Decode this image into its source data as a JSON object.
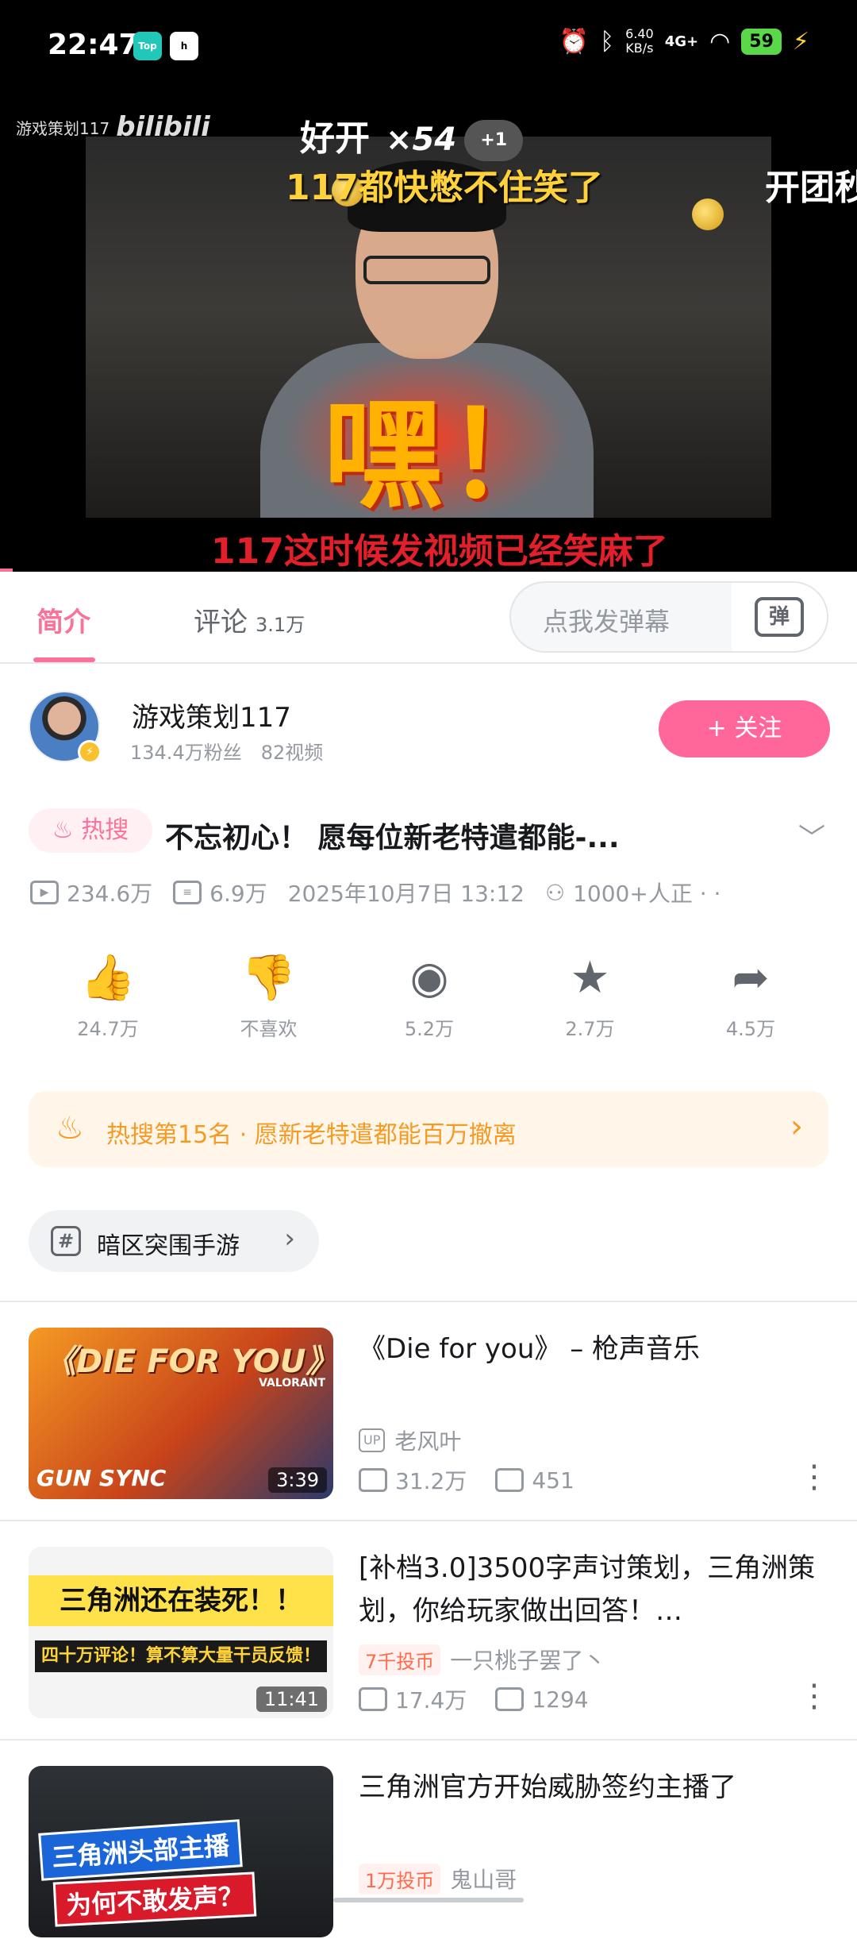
{
  "status_bar": {
    "time": "22:47",
    "app_badges": [
      "Top",
      "h"
    ],
    "net_speed_value": "6.40",
    "net_speed_unit": "KB/s",
    "network": "4G+",
    "battery": "59"
  },
  "player": {
    "watermark": "游戏策划117",
    "watermark_logo": "bilibili",
    "overlay_text": "嘿！",
    "danmu": {
      "combo_text": "好开",
      "combo_mult": "×54",
      "combo_badge": "+1",
      "line2": "117都快憋不住笑了",
      "line3": "开团秒",
      "line4": "117这时候发视频已经笑麻了"
    }
  },
  "tabs": {
    "intro": "简介",
    "comments": "评论",
    "comments_count": "3.1万",
    "danmaku_placeholder": "点我发弹幕",
    "danmaku_button": "弹"
  },
  "uploader": {
    "name": "游戏策划117",
    "fans": "134.4万粉丝",
    "videos": "82视频",
    "follow": "+ 关注"
  },
  "video": {
    "hot_tag": "热搜",
    "title": "不忘初心！ 愿每位新老特遣都能-...",
    "views": "234.6万",
    "danmaku": "6.9万",
    "date": "2025年10月7日 13:12",
    "watching": "1000+人正 · ·"
  },
  "actions": [
    {
      "icon": "thumb-up-icon",
      "count": "24.7万"
    },
    {
      "icon": "thumb-down-icon",
      "count": "不喜欢"
    },
    {
      "icon": "coin-icon",
      "count": "5.2万"
    },
    {
      "icon": "star-icon",
      "count": "2.7万"
    },
    {
      "icon": "share-icon",
      "count": "4.5万"
    }
  ],
  "hot_banner": {
    "text": "热搜第15名 · 愿新老特遣都能百万撤离"
  },
  "topic": {
    "label": "暗区突围手游"
  },
  "recommendations": [
    {
      "title": "《Die for you》 – 枪声音乐",
      "up_tag": "UP",
      "uploader": "老风叶",
      "views": "31.2万",
      "danmaku": "451",
      "duration": "3:39",
      "thumb_text1": "《DIE FOR YOU》",
      "thumb_text2": "GUN SYNC",
      "thumb_text3": "VALORANT"
    },
    {
      "title": "[补档3.0]3500字声讨策划，三角洲策划，你给玩家做出回答！…",
      "coin_tag": "7千投币",
      "uploader": "一只桃子罢了丶",
      "views": "17.4万",
      "danmaku": "1294",
      "duration": "11:41",
      "thumb_text1": "三角洲还在装死！！",
      "thumb_text2": "四十万评论！算不算大量干员反馈！"
    },
    {
      "title": "三角洲官方开始威胁签约主播了",
      "coin_tag": "1万投币",
      "uploader": "鬼山哥",
      "thumb_text1": "三角洲头部主播",
      "thumb_text2": "为何不敢发声？"
    }
  ],
  "colors": {
    "accent": "#fb7299",
    "follow": "#ff6699",
    "hot_orange": "#f59a23"
  }
}
